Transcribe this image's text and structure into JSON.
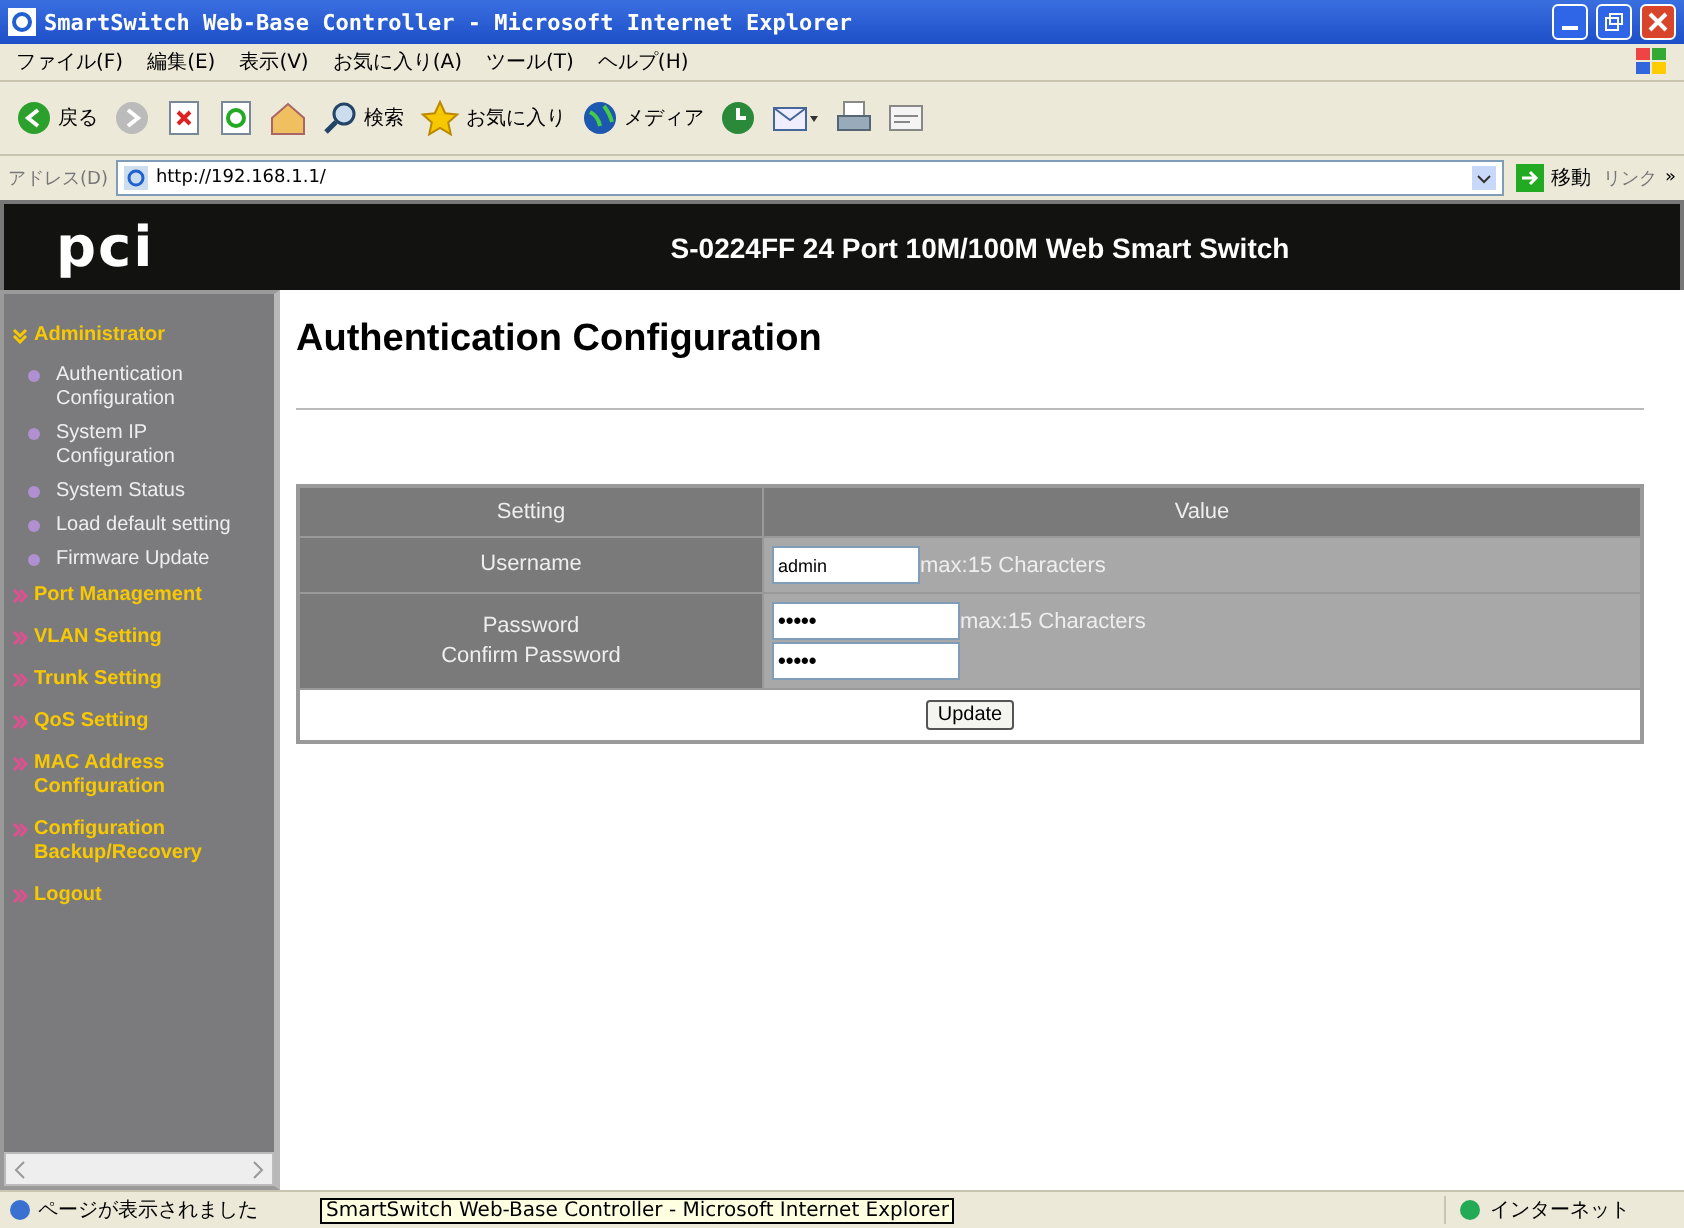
{
  "window": {
    "title": "SmartSwitch Web-Base Controller - Microsoft Internet Explorer"
  },
  "menu": [
    "ファイル(F)",
    "編集(E)",
    "表示(V)",
    "お気に入り(A)",
    "ツール(T)",
    "ヘルプ(H)"
  ],
  "toolbar": [
    {
      "kind": "back",
      "label": "戻る"
    },
    {
      "kind": "forward"
    },
    {
      "kind": "stop"
    },
    {
      "kind": "refresh"
    },
    {
      "kind": "home"
    },
    {
      "kind": "search",
      "label": "検索"
    },
    {
      "kind": "favorites",
      "label": "お気に入り"
    },
    {
      "kind": "media",
      "label": "メディア"
    },
    {
      "kind": "history"
    },
    {
      "kind": "mail"
    },
    {
      "kind": "print"
    },
    {
      "kind": "edit"
    }
  ],
  "address": {
    "label": "アドレス(D)",
    "value": "http://192.168.1.1/",
    "go": "移動",
    "links": "リンク",
    "more": "»"
  },
  "header": {
    "logo": "pci",
    "title": "S-0224FF 24 Port 10M/100M Web Smart Switch"
  },
  "sidebar": [
    {
      "label": "Administrator",
      "expanded": true,
      "children": [
        "Authentication Configuration",
        "System IP Configuration",
        "System Status",
        "Load default setting",
        "Firmware Update"
      ]
    },
    {
      "label": "Port Management",
      "expanded": false
    },
    {
      "label": "VLAN Setting",
      "expanded": false
    },
    {
      "label": "Trunk Setting",
      "expanded": false
    },
    {
      "label": "QoS Setting",
      "expanded": false
    },
    {
      "label": "MAC Address Configuration",
      "expanded": false
    },
    {
      "label": "Configuration Backup/Recovery",
      "expanded": false
    },
    {
      "label": "Logout",
      "expanded": false
    }
  ],
  "page": {
    "title": "Authentication Configuration",
    "table": {
      "columns": [
        "Setting",
        "Value"
      ],
      "rows": [
        {
          "labels": [
            "Username"
          ],
          "fields": [
            {
              "value": "admin",
              "hint": "max:15 Characters"
            }
          ]
        },
        {
          "labels": [
            "Password",
            "Confirm Password"
          ],
          "fields": [
            {
              "value": "•••••",
              "hint": "max:15 Characters"
            },
            {
              "value": "•••••"
            }
          ]
        }
      ],
      "button": "Update"
    }
  },
  "status_bar": {
    "text": "ページが表示されました",
    "tooltip": "SmartSwitch Web-Base Controller - Microsoft Internet Explorer",
    "zone": "インターネット"
  }
}
